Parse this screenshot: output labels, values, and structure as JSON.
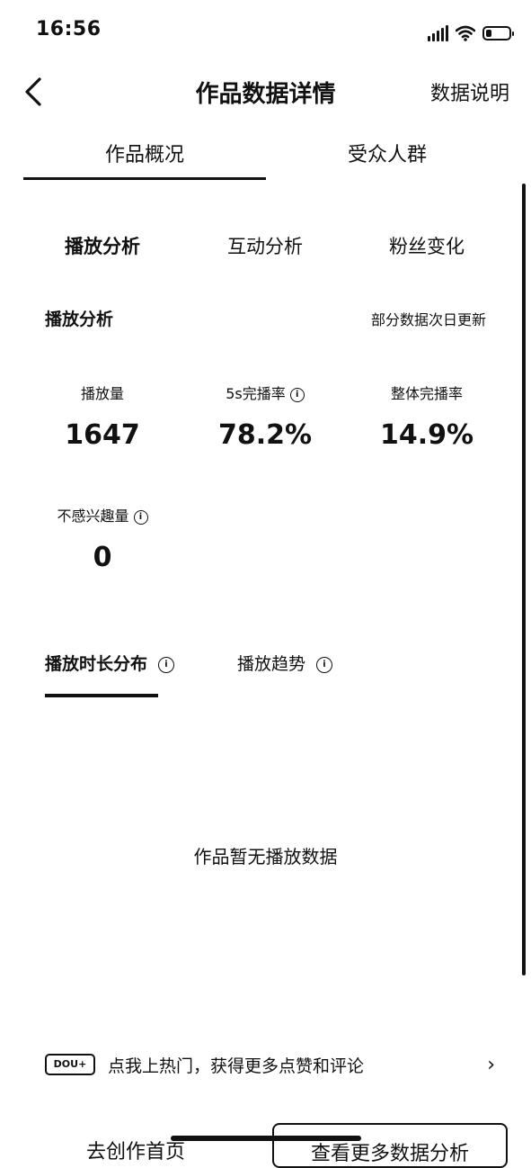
{
  "status": {
    "time": "16:56",
    "battery_level": 0.25
  },
  "nav": {
    "title": "作品数据详情",
    "right_link": "数据说明"
  },
  "tabs": [
    {
      "label": "作品概况",
      "active": true
    },
    {
      "label": "受众人群",
      "active": false
    }
  ],
  "subtabs": [
    {
      "label": "播放分析",
      "active": true
    },
    {
      "label": "互动分析",
      "active": false
    },
    {
      "label": "粉丝变化",
      "active": false
    }
  ],
  "section": {
    "title": "播放分析",
    "note": "部分数据次日更新"
  },
  "stats": [
    {
      "label": "播放量",
      "value": "1647"
    },
    {
      "label": "5s完播率",
      "value": "78.2%"
    },
    {
      "label": "整体完播率",
      "value": "14.9%"
    },
    {
      "label": "不感兴趣量",
      "value": "0"
    }
  ],
  "play_tabs": [
    {
      "label": "播放时长分布",
      "active": true
    },
    {
      "label": "播放趋势",
      "active": false
    }
  ],
  "empty_text": "作品暂无播放数据",
  "promo": {
    "badge": "DOU+",
    "text": "点我上热门，获得更多点赞和评论"
  },
  "bottom": {
    "left_label": "去创作首页",
    "right_button": "查看更多数据分析"
  },
  "colors": {
    "text": "#111111",
    "background": "#ffffff"
  }
}
